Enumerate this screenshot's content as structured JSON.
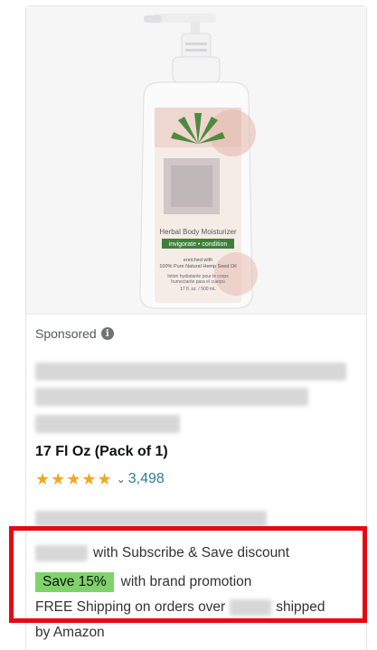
{
  "product": {
    "image_label_name": "Herbal Body Moisturizer",
    "image_label_tag": "invigorate • condition",
    "image_label_small1": "enriched with",
    "image_label_small2": "100% Pure Natural Hemp Seed Oil",
    "image_label_small3": "lotion hydratante pour le corps",
    "image_label_small4": "humectante para el cuerpo",
    "image_label_size": "17 fl. oz. / 500 mL"
  },
  "sponsored_label": "Sponsored",
  "info_glyph": "i",
  "size_option": "17 Fl Oz (Pack of 1)",
  "rating": {
    "stars_glyph": "★★★★★",
    "chevron": "⌄",
    "count": "3,498"
  },
  "offers": {
    "subscribe_text": "with Subscribe & Save discount",
    "badge_text": "Save 15%",
    "promotion_text": "with brand promotion",
    "shipping_prefix": "FREE Shipping on orders over",
    "shipping_suffix": "shipped",
    "shipping_by": "by Amazon"
  },
  "colors": {
    "highlight_border": "#e50914",
    "badge_bg": "#7fd36a",
    "rating_count": "#2e7f8d",
    "stars": "#f5a623"
  },
  "icons": [
    "info-icon",
    "star-icon",
    "chevron-down-icon"
  ]
}
